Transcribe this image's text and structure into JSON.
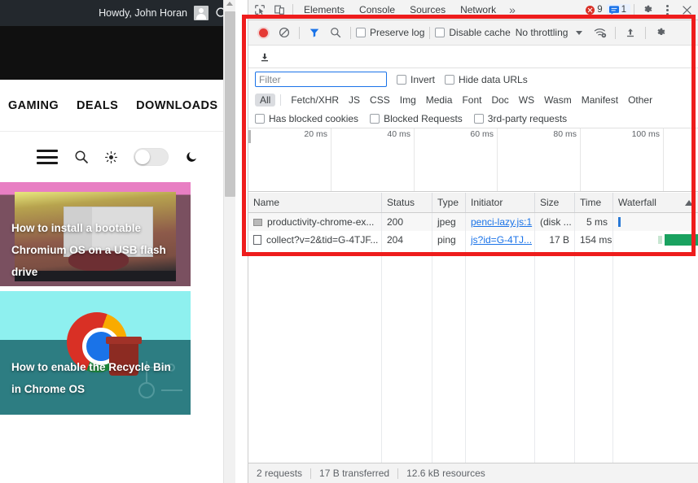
{
  "website": {
    "adminbar": {
      "greeting": "Howdy, John Horan",
      "avatar_icon": "avatar-icon",
      "search_icon": "search-icon"
    },
    "nav_items": [
      "GAMING",
      "DEALS",
      "DOWNLOADS"
    ],
    "toolrow": {
      "menu_icon": "hamburger-icon",
      "search_icon": "search-icon",
      "light_icon": "sun-icon",
      "dark_icon": "moon-icon",
      "theme_toggle_state": "off"
    },
    "cards": [
      {
        "title": "How to install a bootable Chromium OS on a USB flash drive"
      },
      {
        "title": "How to enable the Recycle Bin in Chrome OS"
      }
    ]
  },
  "devtools": {
    "tabbar": {
      "inspect_icon": "inspect-element-icon",
      "device_icon": "device-toolbar-icon",
      "tabs": [
        "Elements",
        "Console",
        "Sources",
        "Network"
      ],
      "more_tabs": "»",
      "error_count": "9",
      "message_count": "1",
      "settings_icon": "gear-icon",
      "more_icon": "kebab-menu-icon",
      "close_icon": "close-icon"
    },
    "toolbar": {
      "record_icon": "record-icon",
      "clear_icon": "clear-icon",
      "filter_icon": "filter-icon",
      "search_icon": "search-icon",
      "preserve_log": "Preserve log",
      "disable_cache": "Disable cache",
      "throttling": "No throttling",
      "caret_icon": "chevron-down-icon",
      "network_conditions_icon": "wifi-settings-icon",
      "import_icon": "upload-icon",
      "settings_icon": "gear-icon",
      "export_icon": "download-icon"
    },
    "filters": {
      "input_placeholder": "Filter",
      "input_value": "",
      "invert": "Invert",
      "hide_data_urls": "Hide data URLs",
      "types": [
        "All",
        "Fetch/XHR",
        "JS",
        "CSS",
        "Img",
        "Media",
        "Font",
        "Doc",
        "WS",
        "Wasm",
        "Manifest",
        "Other"
      ],
      "active_type": "All",
      "has_blocked_cookies": "Has blocked cookies",
      "blocked_requests": "Blocked Requests",
      "third_party_requests": "3rd-party requests"
    },
    "overview": {
      "ticks": [
        "20 ms",
        "40 ms",
        "60 ms",
        "80 ms",
        "100 ms"
      ]
    },
    "table": {
      "columns": [
        "Name",
        "Status",
        "Type",
        "Initiator",
        "Size",
        "Time",
        "Waterfall"
      ],
      "sort_indicator": "sort-ascending-icon",
      "rows": [
        {
          "icon": "image-file-icon",
          "name": "productivity-chrome-ex...",
          "status": "200",
          "type": "jpeg",
          "initiator": "penci-lazy.js:1",
          "size": "(disk ...",
          "time": "5 ms",
          "waterfall_color": "#2979d6"
        },
        {
          "icon": "document-file-icon",
          "name": "collect?v=2&tid=G-4TJF...",
          "status": "204",
          "type": "ping",
          "initiator": "js?id=G-4TJ...",
          "size": "17 B",
          "time": "154 ms",
          "waterfall_color": "#1aa260"
        }
      ]
    },
    "status": {
      "requests": "2 requests",
      "transferred": "17 B transferred",
      "resources": "12.6 kB resources"
    }
  },
  "annotation": {
    "color": "#ee1c1c"
  }
}
